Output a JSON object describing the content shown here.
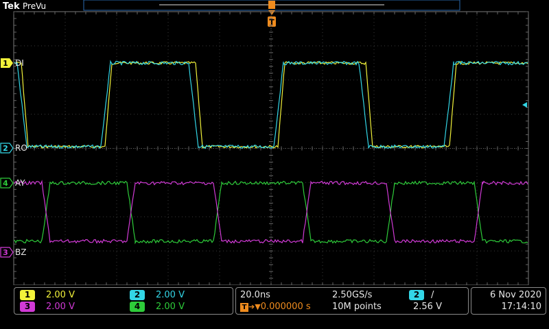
{
  "brand": {
    "logo": "Tek",
    "mode": "PreVu"
  },
  "colors": {
    "ch1": "#f2f23a",
    "ch2": "#33d6e6",
    "ch3": "#d13ad6",
    "ch4": "#2ecc3a",
    "trigger": "#f08c1e",
    "grid": "#3a3a3a",
    "frame": "#7a7a7a"
  },
  "markers": {
    "trigger_letter": "T"
  },
  "channels": [
    {
      "id": "1",
      "label": "DI",
      "color": "#f2f23a"
    },
    {
      "id": "2",
      "label": "RO",
      "color": "#33d6e6"
    },
    {
      "id": "4",
      "label": "AY",
      "color": "#2ecc3a"
    },
    {
      "id": "3",
      "label": "BZ",
      "color": "#d13ad6"
    }
  ],
  "status": {
    "ch1": {
      "num": "1",
      "scale": "2.00 V"
    },
    "ch2": {
      "num": "2",
      "scale": "2.00 V"
    },
    "ch3": {
      "num": "3",
      "scale": "2.00 V"
    },
    "ch4": {
      "num": "4",
      "scale": "2.00 V"
    },
    "timebase": "20.0ns",
    "sample_rate": "2.50GS/s",
    "position": "0.000000 s",
    "record": "10M points",
    "trig_source": "2",
    "trig_slope": "/",
    "trig_level": "2.56 V",
    "date": "6 Nov 2020",
    "time": "17:14:10"
  }
}
